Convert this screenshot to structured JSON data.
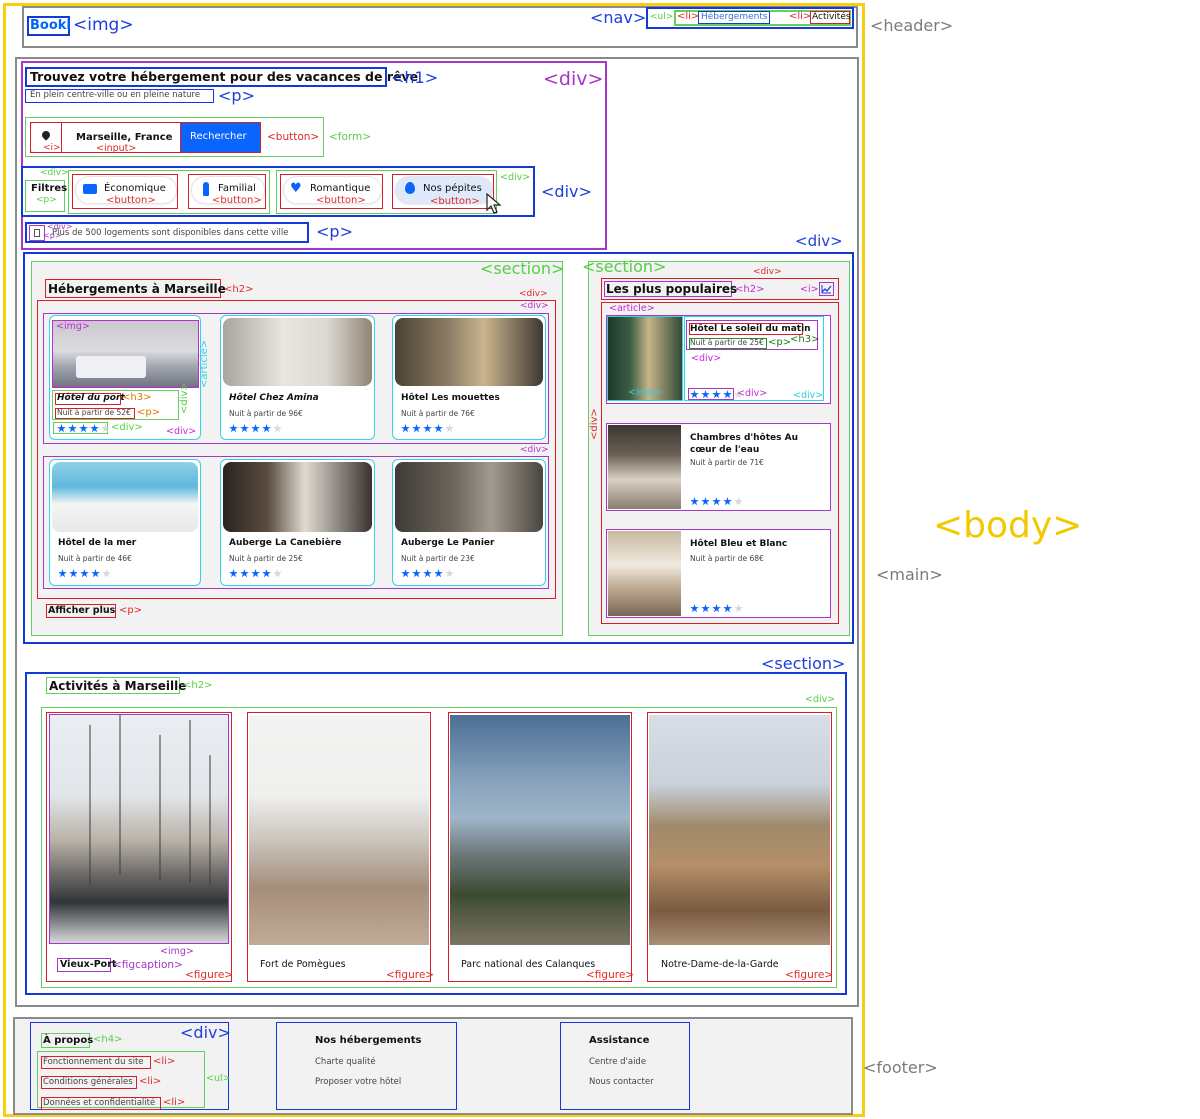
{
  "labels": {
    "header": "<header>",
    "body": "<body>",
    "main": "<main>",
    "footer": "<footer>",
    "img": "<img>",
    "nav": "<nav>",
    "ul": "<ul>",
    "li": "<li>",
    "h1": "<h1>",
    "p": "<p>",
    "div": "<div>",
    "form": "<form>",
    "button": "<button>",
    "input": "<input>",
    "i": "<i>",
    "section": "<section>",
    "h2": "<h2>",
    "h3": "<h3>",
    "h4": "<h4>",
    "article": "<article>",
    "figure": "<figure>",
    "figcaption": "<figcaption>"
  },
  "brand": "Booki",
  "nav": {
    "item1": "Hébergements",
    "item2": "Activités"
  },
  "hero": {
    "title": "Trouvez votre hébergement pour des vacances de rêve",
    "subtitle": "En plein centre-ville ou en pleine nature",
    "search_value": "Marseille, France",
    "search_button": "Rechercher",
    "filters_label": "Filtres",
    "filters": [
      "Économique",
      "Familial",
      "Romantique",
      "Nos pépites"
    ],
    "info": "Plus de 500 logements sont disponibles dans cette ville"
  },
  "accommodations": {
    "title": "Hébergements à Marseille",
    "items": [
      {
        "name": "Hôtel du port",
        "price": "Nuit à partir de 52€",
        "rating": 4
      },
      {
        "name": "Hôtel Chez Amina",
        "price": "Nuit à partir de 96€",
        "rating": 4
      },
      {
        "name": "Hôtel Les mouettes",
        "price": "Nuit à partir de 76€",
        "rating": 4
      },
      {
        "name": "Hôtel de la mer",
        "price": "Nuit à partir de 46€",
        "rating": 4
      },
      {
        "name": "Auberge La Canebière",
        "price": "Nuit à partir de 25€",
        "rating": 4
      },
      {
        "name": "Auberge Le Panier",
        "price": "Nuit à partir de 23€",
        "rating": 4
      }
    ],
    "more": "Afficher plus"
  },
  "popular": {
    "title": "Les plus populaires",
    "items": [
      {
        "name": "Hôtel Le soleil du matin",
        "price": "Nuit à partir de 25€",
        "rating": 4
      },
      {
        "name": "Chambres d'hôtes Au cœur de l'eau",
        "price": "Nuit à partir de 71€",
        "rating": 4
      },
      {
        "name": "Hôtel Bleu et Blanc",
        "price": "Nuit à partir de 68€",
        "rating": 4
      }
    ]
  },
  "activities": {
    "title": "Activités à Marseille",
    "items": [
      "Vieux-Port",
      "Fort de Pomègues",
      "Parc national des Calanques",
      "Notre-Dame-de-la-Garde"
    ]
  },
  "footer": {
    "col1_title": "À propos",
    "col1_links": [
      "Fonctionnement du site",
      "Conditions générales",
      "Données et confidentialité"
    ],
    "col2_title": "Nos hébergements",
    "col2_links": [
      "Charte qualité",
      "Proposer votre hôtel"
    ],
    "col3_title": "Assistance",
    "col3_links": [
      "Centre d'aide",
      "Nous contacter"
    ]
  },
  "colors": {
    "brand_blue": "#0065fc",
    "body_outline": "#f7cf11"
  }
}
